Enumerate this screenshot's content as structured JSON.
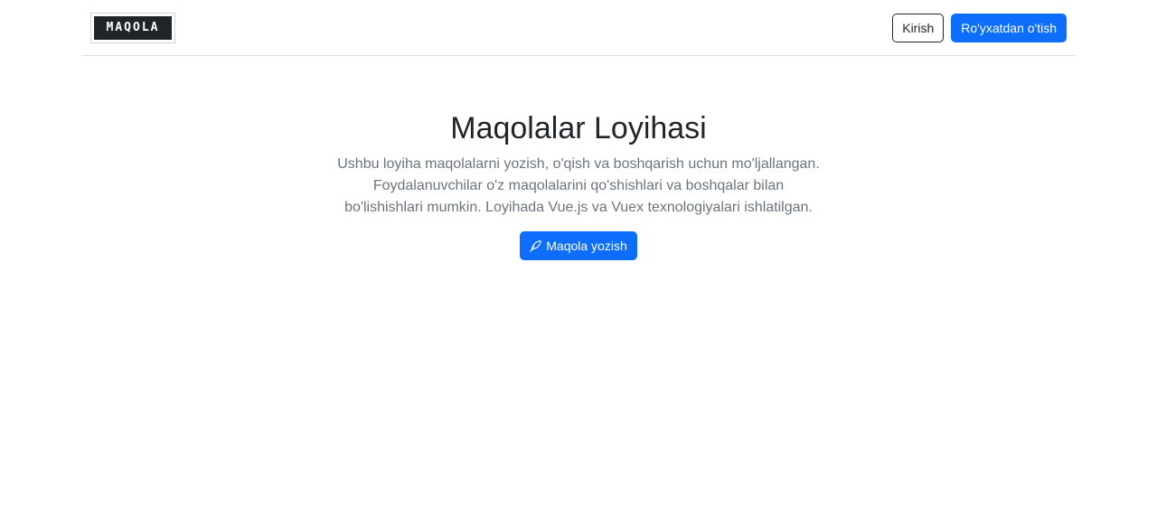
{
  "header": {
    "logo_text": "MAQOLA",
    "login_label": "Kirish",
    "register_label": "Ro'yxatdan o'tish"
  },
  "hero": {
    "title": "Maqolalar Loyihasi",
    "description": "Ushbu loyiha maqolalarni yozish, o'qish va boshqarish uchun mo'ljallangan. Foydalanuvchilar o'z maqolalarini qo'shishlari va boshqalar bilan bo'lishishlari mumkin. Loyihada Vue.js va Vuex texnologiyalari ishlatilgan.",
    "cta_label": "Maqola yozish",
    "cta_icon": "feather-pen-icon"
  },
  "colors": {
    "primary": "#0d6efd",
    "dark": "#212529",
    "muted": "#6c757d"
  }
}
